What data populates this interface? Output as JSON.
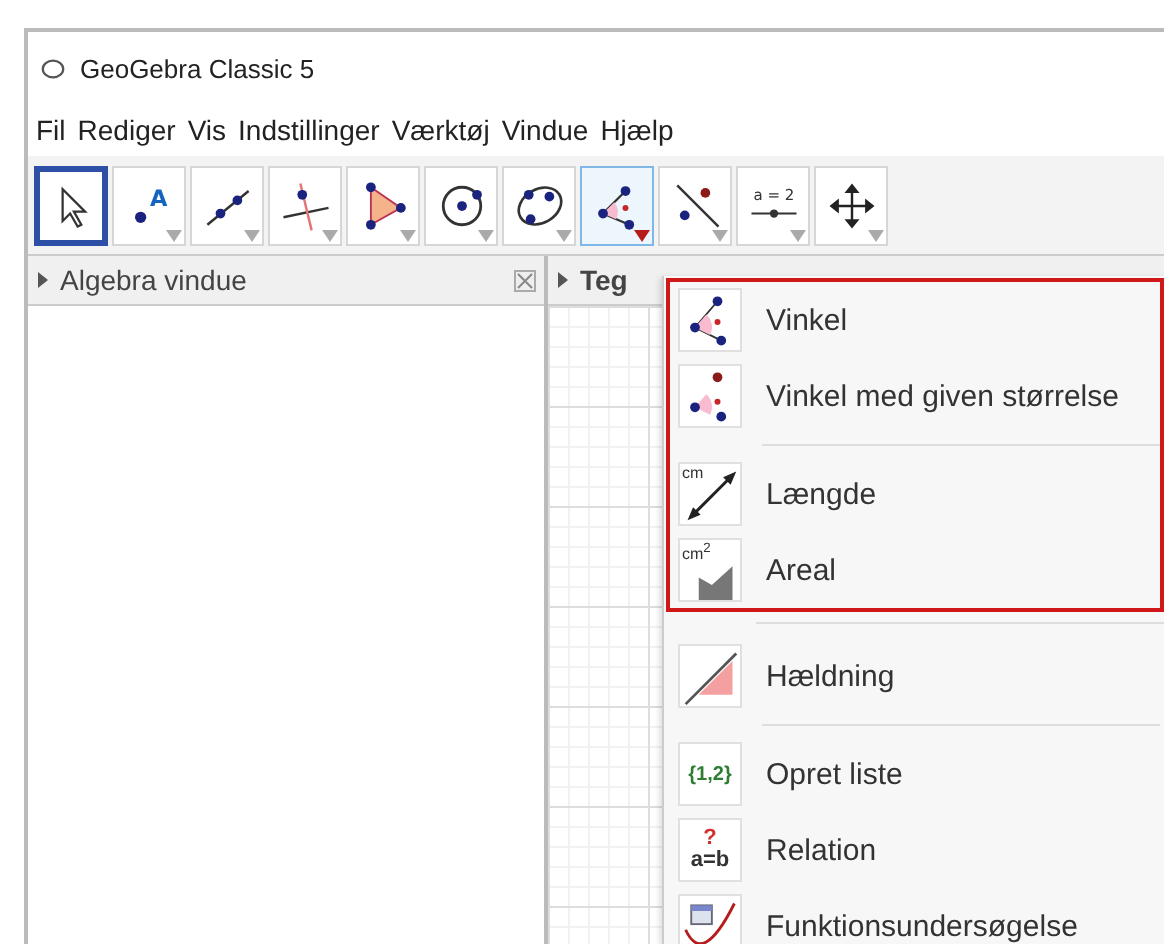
{
  "window": {
    "title": "GeoGebra Classic 5"
  },
  "menu_bar": [
    "Fil",
    "Rediger",
    "Vis",
    "Indstillinger",
    "Værktøj",
    "Vindue",
    "Hjælp"
  ],
  "toolbar": [
    {
      "selected": true,
      "open": false
    },
    {
      "selected": false,
      "open": false,
      "icon_label": "A"
    },
    {
      "selected": false,
      "open": false
    },
    {
      "selected": false,
      "open": false
    },
    {
      "selected": false,
      "open": false
    },
    {
      "selected": false,
      "open": false
    },
    {
      "selected": false,
      "open": false
    },
    {
      "selected": false,
      "open": true
    },
    {
      "selected": false,
      "open": false
    },
    {
      "selected": false,
      "open": false,
      "icon_label": "a = 2"
    },
    {
      "selected": false,
      "open": false
    }
  ],
  "algebra_panel": {
    "title": "Algebra vindue"
  },
  "graphics_panel": {
    "title": "Teg"
  },
  "dropdown": {
    "sections": [
      {
        "highlighted": true,
        "groups": [
          [
            {
              "label": "Vinkel",
              "kind": "angle"
            },
            {
              "label": "Vinkel med given størrelse",
              "kind": "anglesize"
            }
          ],
          [
            {
              "label": "Længde",
              "kind": "length",
              "icon_label": "cm"
            },
            {
              "label": "Areal",
              "kind": "area",
              "icon_label": "cm$^{2}$"
            }
          ]
        ]
      },
      {
        "highlighted": false,
        "groups": [
          [
            {
              "label": "Hældning",
              "kind": "slope"
            }
          ],
          [
            {
              "label": "Opret liste",
              "kind": "list",
              "icon_label": "{1,2}"
            },
            {
              "label": "Relation",
              "kind": "relation",
              "icon_label": "a=b",
              "icon_mark": "?"
            },
            {
              "label": "Funktionsundersøgelse",
              "kind": "function"
            }
          ]
        ]
      }
    ]
  }
}
